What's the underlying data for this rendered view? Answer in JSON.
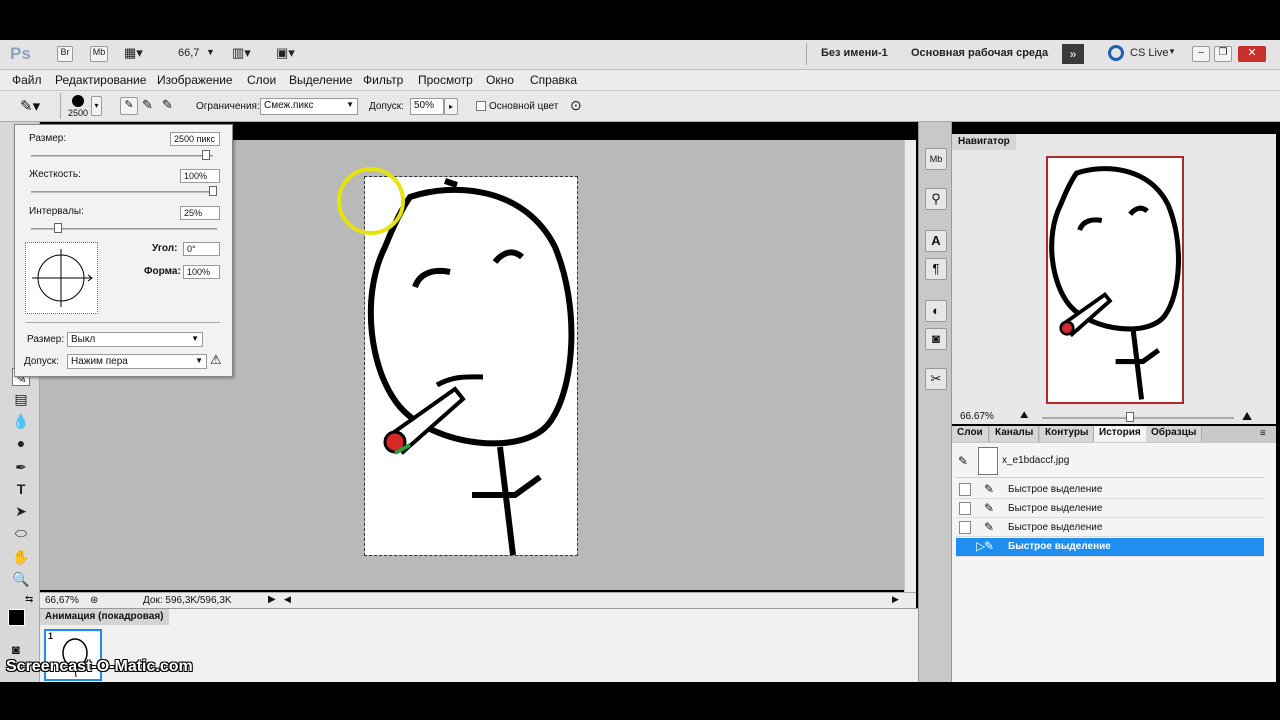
{
  "app": {
    "logo": "Ps",
    "bridge": "Br",
    "mini_bridge": "Mb",
    "zoom": "66,7",
    "doc_name": "Без имени-1",
    "workspace": "Основная рабочая среда",
    "cs_live": "CS Live"
  },
  "menu": [
    "Файл",
    "Редактирование",
    "Изображение",
    "Слои",
    "Выделение",
    "Фильтр",
    "Просмотр",
    "Окно",
    "Справка"
  ],
  "options": {
    "brush_size": "2500",
    "limit_label": "Ограничения:",
    "limit_value": "Смеж.пикс",
    "tolerance_label": "Допуск:",
    "tolerance_value": "50%",
    "main_color_label": "Основной цвет"
  },
  "brush": {
    "size_label": "Размер:",
    "size_value": "2500 пикс",
    "hardness_label": "Жесткость:",
    "hardness_value": "100%",
    "spacing_label": "Интервалы:",
    "spacing_value": "25%",
    "angle_label": "Угол:",
    "angle_value": "0°",
    "roundness_label": "Форма:",
    "roundness_value": "100%",
    "size_ctrl_label": "Размер:",
    "size_ctrl_value": "Выкл",
    "tol_label": "Допуск:",
    "tol_value": "Нажим пера",
    "size_fraction": 0.98,
    "hardness_fraction": 1.0,
    "spacing_fraction": 0.13
  },
  "status": {
    "zoom": "66,67%",
    "doc": "Док: 596,3K/596,3K"
  },
  "animation": {
    "title": "Анимация (покадровая)",
    "frame": "1"
  },
  "navigator": {
    "title": "Навигатор",
    "zoom": "66.67%"
  },
  "panels": {
    "tabs": [
      "Слои",
      "Каналы",
      "Контуры",
      "История",
      "Образцы"
    ],
    "active": "История",
    "snapshot": "x_e1bdaccf.jpg",
    "history": [
      "Быстрое выделение",
      "Быстрое выделение",
      "Быстрое выделение",
      "Быстрое выделение"
    ]
  },
  "watermark": "Screencast-O-Matic.com",
  "colors": {
    "selection": "#1e8ff0",
    "nav_frame": "#b3262b"
  }
}
